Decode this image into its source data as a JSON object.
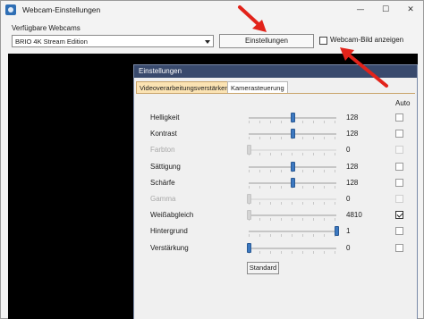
{
  "window": {
    "title": "Webcam-Einstellungen",
    "controls": {
      "minimize": "—",
      "maximize": "☐",
      "close": "✕"
    }
  },
  "webcam": {
    "label": "Verfügbare Webcams",
    "selected": "BRIO 4K Stream Edition",
    "settings_button": "Einstellungen",
    "show_image_label": "Webcam-Bild anzeigen",
    "show_image_checked": false
  },
  "dialog": {
    "title": "Einstellungen",
    "tabs": [
      "Videoverarbeitungsverstärker",
      "Kamerasteuerung"
    ],
    "active_tab": 0,
    "auto_header": "Auto",
    "rows": [
      {
        "label": "Helligkeit",
        "value": "128",
        "level": 0.5,
        "enabled": true,
        "auto": false
      },
      {
        "label": "Kontrast",
        "value": "128",
        "level": 0.5,
        "enabled": true,
        "auto": false
      },
      {
        "label": "Farbton",
        "value": "0",
        "level": 0.0,
        "enabled": false,
        "auto": false
      },
      {
        "label": "Sättigung",
        "value": "128",
        "level": 0.5,
        "enabled": true,
        "auto": false
      },
      {
        "label": "Schärfe",
        "value": "128",
        "level": 0.5,
        "enabled": true,
        "auto": false
      },
      {
        "label": "Gamma",
        "value": "0",
        "level": 0.0,
        "enabled": false,
        "auto": false
      },
      {
        "label": "Weißabgleich",
        "value": "4810",
        "level": 0.0,
        "enabled": true,
        "auto": true,
        "thumb_disabled": true
      },
      {
        "label": "Hintergrund",
        "value": "1",
        "level": 1.0,
        "enabled": true,
        "auto": false
      },
      {
        "label": "Verstärkung",
        "value": "0",
        "level": 0.0,
        "enabled": true,
        "auto": false
      }
    ],
    "standard_button": "Standard"
  },
  "annotations": {
    "arrow_color": "#e2231a"
  }
}
